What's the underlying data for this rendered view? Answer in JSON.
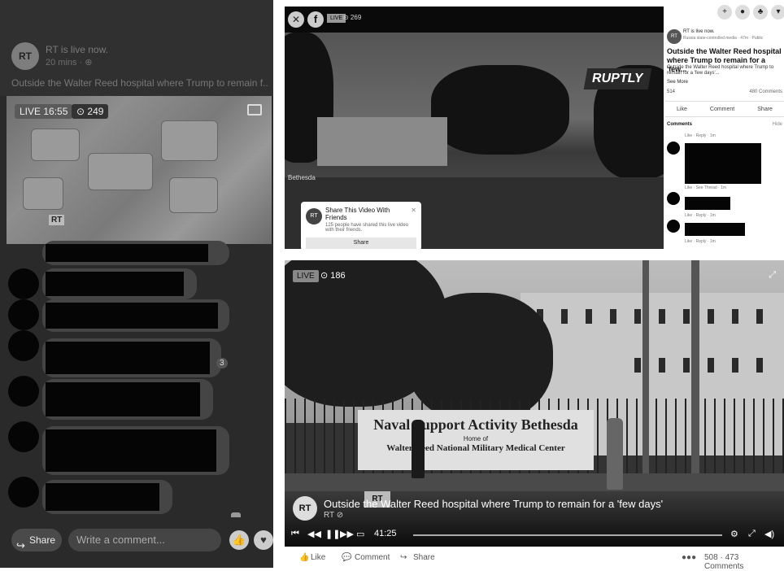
{
  "left": {
    "channel": "RT",
    "live_status": "RT is live now.",
    "time": "20 mins · ⊕",
    "caption": "Outside the Walter Reed hospital where Trump to remain f...",
    "live_label": "LIVE 16:55",
    "viewers": "⊙ 249",
    "logo_small": "RT",
    "like_count": "3",
    "share_label": "Share",
    "comment_placeholder": "Write a comment..."
  },
  "top_right": {
    "live_label": "LIVE",
    "viewers": "⊙ 269",
    "watermark": "RUPTLY",
    "rt_tag": "Bethesda",
    "share_popup": {
      "title": "Share This Video With Friends",
      "subtitle": "125 people have shared this live video with their friends.",
      "button": "Share"
    },
    "post": {
      "channel": "RT",
      "name_line": "RT is live now.",
      "sub": "Russia state-controlled media · 47m · Public",
      "title": "Outside the Walter Reed hospital where Trump to remain for a 'few...",
      "desc": "Outside the Walter Reed hospital where Trump to remain for a 'few days'...",
      "see_more": "See More",
      "reactions": "514",
      "comments_count": "480 Comments",
      "like": "Like",
      "comment": "Comment",
      "share": "Share",
      "comments_header": "Comments",
      "hide": "Hide",
      "meta1": "Like · Reply · 1m",
      "meta2": "Like · See Thread · 1m",
      "meta3": "Like · Reply · 1m",
      "meta4": "Like · Reply · 1m"
    }
  },
  "bottom_right": {
    "live_label": "LIVE",
    "viewers": "⊙ 186",
    "sign_line1": "Naval Support Activity Bethesda",
    "sign_line2": "Home of",
    "sign_line3": "Walter Reed National Military Medical Center",
    "channel_logo": "RT",
    "video_title": "Outside the Walter Reed hospital where Trump to remain for a 'few days'",
    "channel_name": "RT ⊘",
    "time": "41:25",
    "like": "Like",
    "comment": "Comment",
    "share": "Share",
    "stats": "508 · 473 Comments"
  }
}
